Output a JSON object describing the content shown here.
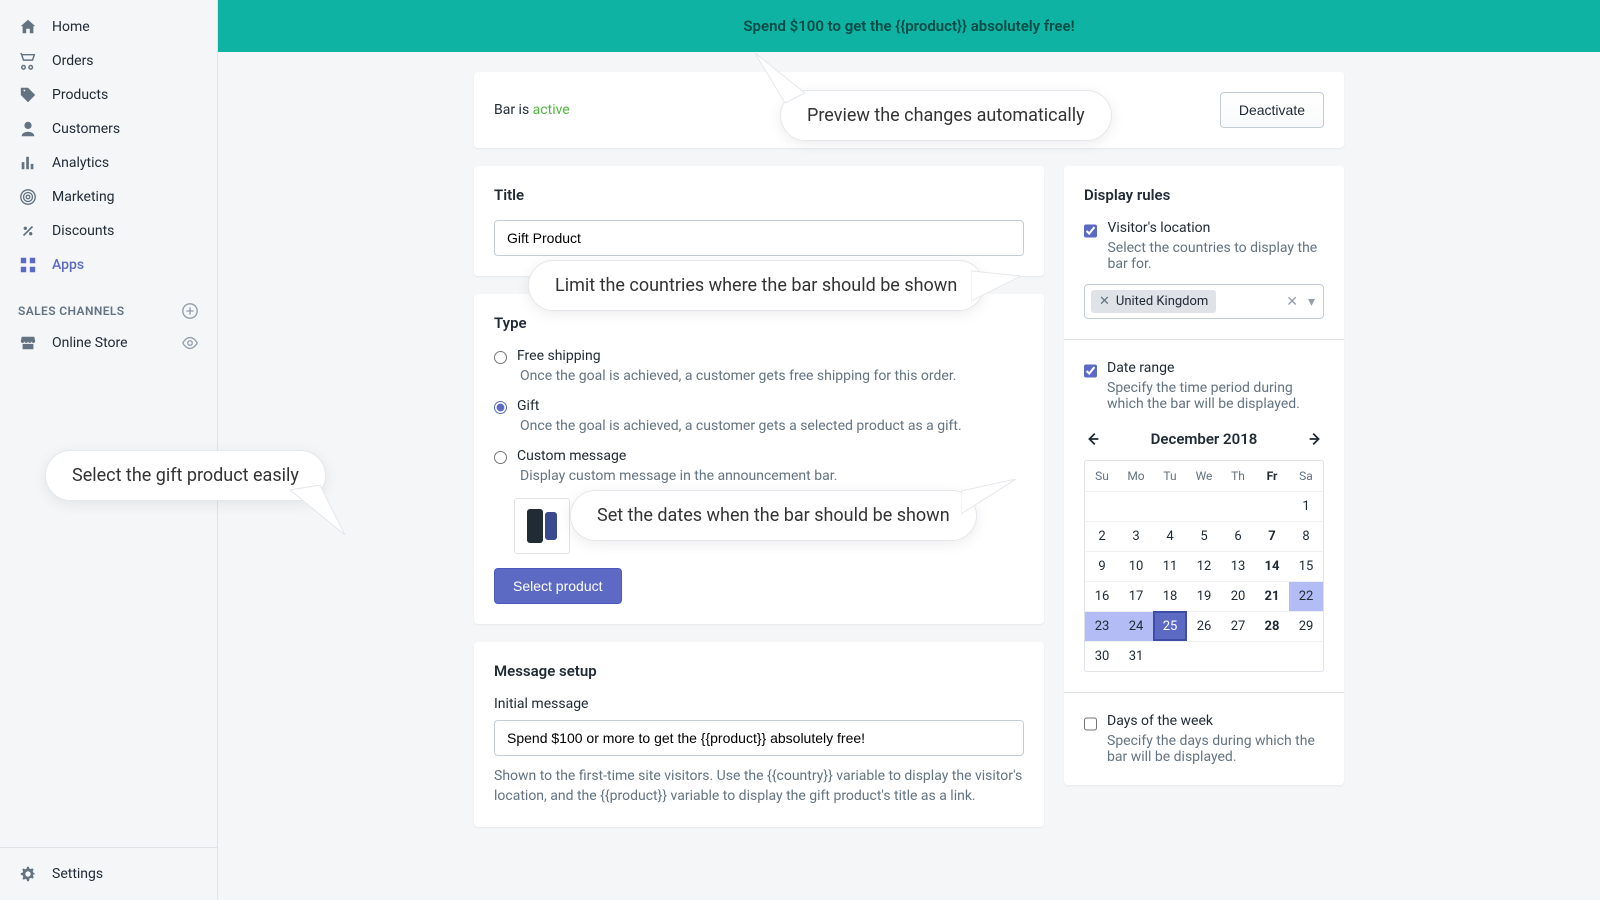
{
  "sidebar": {
    "items": [
      {
        "label": "Home",
        "icon": "home"
      },
      {
        "label": "Orders",
        "icon": "orders"
      },
      {
        "label": "Products",
        "icon": "products"
      },
      {
        "label": "Customers",
        "icon": "customers"
      },
      {
        "label": "Analytics",
        "icon": "analytics"
      },
      {
        "label": "Marketing",
        "icon": "marketing"
      },
      {
        "label": "Discounts",
        "icon": "discounts"
      },
      {
        "label": "Apps",
        "icon": "apps",
        "active": true
      }
    ],
    "section_label": "SALES CHANNELS",
    "channel": "Online Store",
    "settings": "Settings"
  },
  "announcement": {
    "text": "Spend $100 to get the {{product}} absolutely free!"
  },
  "status_bar": {
    "prefix": "Bar is ",
    "status": "active",
    "deactivate": "Deactivate"
  },
  "title_card": {
    "heading": "Title",
    "value": "Gift Product"
  },
  "type_card": {
    "heading": "Type",
    "free_shipping": {
      "label": "Free shipping",
      "help": "Once the goal is achieved, a customer gets free shipping for this order."
    },
    "gift": {
      "label": "Gift",
      "help": "Once the goal is achieved, a customer gets a selected product as a gift."
    },
    "custom": {
      "label": "Custom message",
      "help": "Display custom message in the announcement bar."
    },
    "select_product": "Select product"
  },
  "message_card": {
    "heading": "Message setup",
    "initial_label": "Initial message",
    "initial_value": "Spend $100 or more to get the {{product}} absolutely free!",
    "help": "Shown to the first-time site visitors. Use the {{country}} variable to display the visitor's location, and the {{product}} variable to display the gift product's title as a link."
  },
  "display_rules": {
    "heading": "Display rules",
    "location": {
      "label": "Visitor's location",
      "help": "Select the countries to display the bar for.",
      "tag": "United Kingdom"
    },
    "date_range": {
      "label": "Date range",
      "help": "Specify the time period during which the bar will be displayed.",
      "month": "December 2018",
      "dow": [
        "Su",
        "Mo",
        "Tu",
        "We",
        "Th",
        "Fr",
        "Sa"
      ]
    },
    "days_of_week": {
      "label": "Days of the week",
      "help": "Specify the days during which the bar will be displayed."
    }
  },
  "callouts": {
    "preview": "Preview the changes automatically",
    "countries": "Limit the countries where the bar should be shown",
    "dates": "Set the dates when the bar should be shown",
    "gift": "Select the gift product easily"
  }
}
